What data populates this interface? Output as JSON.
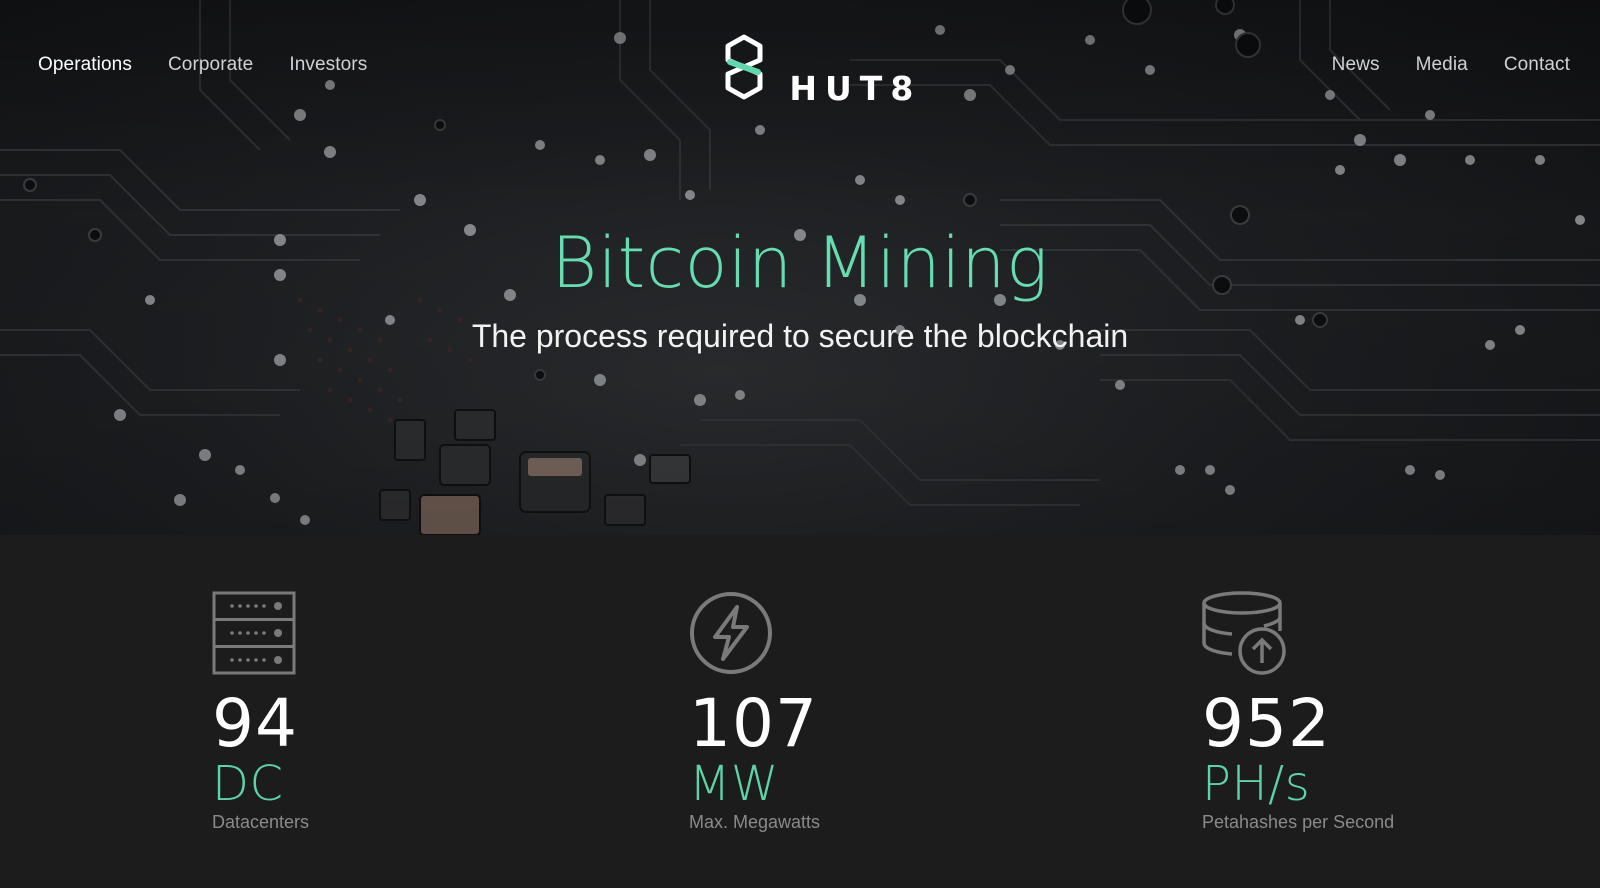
{
  "nav": {
    "left": [
      {
        "label": "Operations",
        "active": true
      },
      {
        "label": "Corporate",
        "active": false
      },
      {
        "label": "Investors",
        "active": false
      }
    ],
    "right": [
      {
        "label": "News"
      },
      {
        "label": "Media"
      },
      {
        "label": "Contact"
      }
    ]
  },
  "logo": {
    "text": "HUT8",
    "icon": "hut8-hexagon-logo-icon",
    "accent_color": "#62d7ab"
  },
  "hero": {
    "title": "Bitcoin Mining",
    "subtitle": "The process required to secure the blockchain",
    "background": "circuit-board-photo",
    "title_color": "#66dcb0"
  },
  "stats": [
    {
      "icon": "server-rack-icon",
      "value": "94",
      "unit": "DC",
      "label": "Datacenters"
    },
    {
      "icon": "lightning-bolt-icon",
      "value": "107",
      "unit": "MW",
      "label": "Max. Megawatts"
    },
    {
      "icon": "database-upload-icon",
      "value": "952",
      "unit": "PH/s",
      "label": "Petahashes per Second"
    }
  ],
  "colors": {
    "accent": "#5fd3a8",
    "stats_background": "#1c1c1c",
    "icon_gray": "#7a7a7a"
  }
}
